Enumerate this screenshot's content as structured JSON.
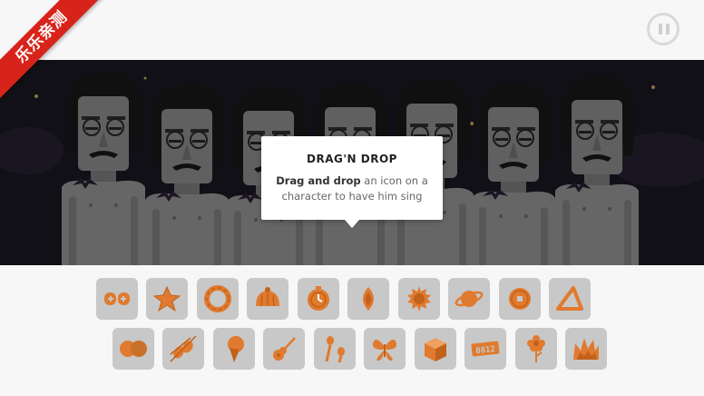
{
  "corner_ribbon": {
    "text": "乐乐亲测"
  },
  "tooltip": {
    "title": "DRAG'N DROP",
    "body_strong": "Drag and drop",
    "body_rest": " an icon on a character to have him sing"
  },
  "colors": {
    "accent": "#e07a2e",
    "icon_tile": "#c8c8c8",
    "stage_bg": "#1d1a26",
    "ribbon": "#d8231a"
  },
  "characters": {
    "count": 7
  },
  "icons": {
    "row1": [
      "gamepad-icon",
      "star-icon",
      "donut-ring-icon",
      "pudding-icon",
      "clock-icon",
      "leaf-drop-icon",
      "sun-icon",
      "planet-icon",
      "coin-icon",
      "triangle-icon"
    ],
    "row2": [
      "double-ball-icon",
      "violins-icon",
      "ice-cream-icon",
      "guitar-icon",
      "maracas-icon",
      "butterfly-icon",
      "cube-icon",
      "number-plate-icon",
      "flower-icon",
      "crown-flame-icon"
    ],
    "plate_text": "0812"
  }
}
